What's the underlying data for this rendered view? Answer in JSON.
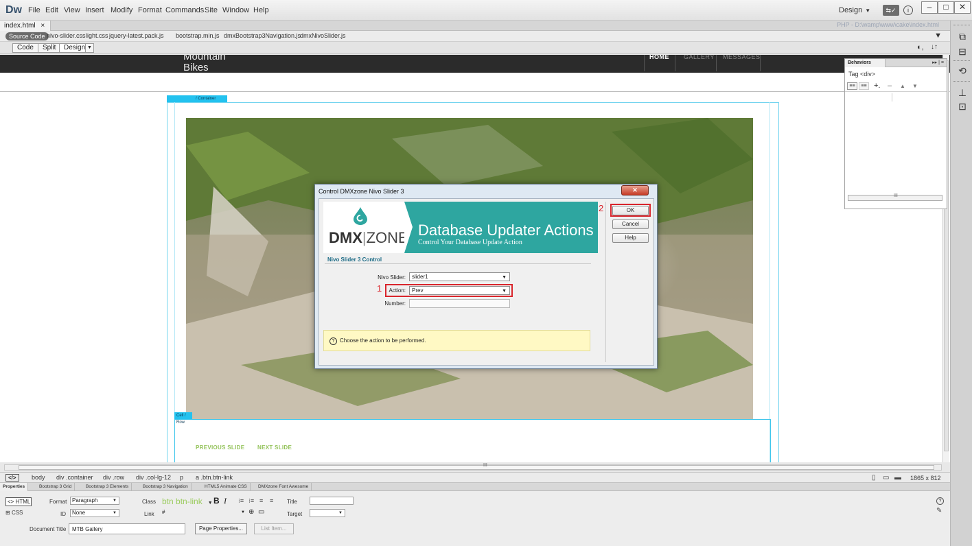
{
  "app": {
    "logo": "Dw",
    "menu": [
      "File",
      "Edit",
      "View",
      "Insert",
      "Modify",
      "Format",
      "Commands",
      "Site",
      "Window",
      "Help"
    ],
    "workspace": "Design",
    "window_controls": [
      "–",
      "□",
      "✕"
    ]
  },
  "document": {
    "tab_label": "index.html",
    "tab_close": "×",
    "path": "PHP - D:\\wamp\\www\\cake\\index.html"
  },
  "related_files": {
    "source_label": "Source Code",
    "files": [
      "nivo-slider.css",
      "light.css",
      "jquery-latest.pack.js",
      "bootstrap.min.js",
      "dmxBootstrap3Navigation.js",
      "dmxNivoSlider.js"
    ]
  },
  "view_bar": {
    "code": "Code",
    "split": "Split",
    "design": "Design"
  },
  "site": {
    "brand_line1": "Mountain",
    "brand_line2": "Bikes",
    "nav": [
      "HOME",
      "GALLERY",
      "MESSAGES"
    ],
    "container_label": "/ Container",
    "cellrow_label": "Cell / Row",
    "prev_label": "PREVIOUS SLIDE",
    "next_label": "NEXT SLIDE"
  },
  "behaviors": {
    "title": "Behaviors",
    "tag": "Tag <div>",
    "scroll_label": "III"
  },
  "tag_selector": {
    "icon": "</>",
    "crumbs": [
      "body",
      "div .container",
      "div .row",
      "div .col-lg-12",
      "p",
      "a .btn.btn-link"
    ],
    "dimensions": "1865 x 812"
  },
  "hscroll_label": "III",
  "properties": {
    "tabs": [
      "Properties",
      "Bootstrap 3 Grid",
      "Bootstrap 3 Elements",
      "Bootstrap 3 Navigation",
      "HTML5 Animate CSS",
      "DMXzone Font Awesome"
    ],
    "html_label": "<> HTML",
    "css_label": "CSS",
    "format_label": "Format",
    "format_value": "Paragraph",
    "class_label": "Class",
    "class_value": "btn btn-link",
    "id_label": "ID",
    "id_value": "None",
    "link_label": "Link",
    "link_value": "#",
    "target_label": "Target",
    "title_label": "Title",
    "doc_title_label": "Document Title",
    "doc_title_value": "MTB Gallery",
    "page_props_label": "Page Properties...",
    "list_item_label": "List Item..."
  },
  "dialog": {
    "title": "Control DMXzone Nivo Slider 3",
    "logo_text_bold": "DMX",
    "logo_text_light": "ZONE",
    "banner_title": "Database Updater Actions",
    "banner_subtitle": "Control Your Database Update Action",
    "section_title": "Nivo Slider 3 Control",
    "nivo_label": "Nivo Slider:",
    "nivo_value": "slider1",
    "action_label": "Action:",
    "action_value": "Prev",
    "number_label": "Number:",
    "number_value": "",
    "hint": "Choose the action to be performed.",
    "ok": "OK",
    "cancel": "Cancel",
    "help": "Help",
    "step1": "1",
    "step2": "2"
  },
  "colors": {
    "accent_teal": "#2ea6a0",
    "highlight_red": "#d9252c",
    "link_green": "#94c35b",
    "guide_cyan": "#23c2ef"
  }
}
